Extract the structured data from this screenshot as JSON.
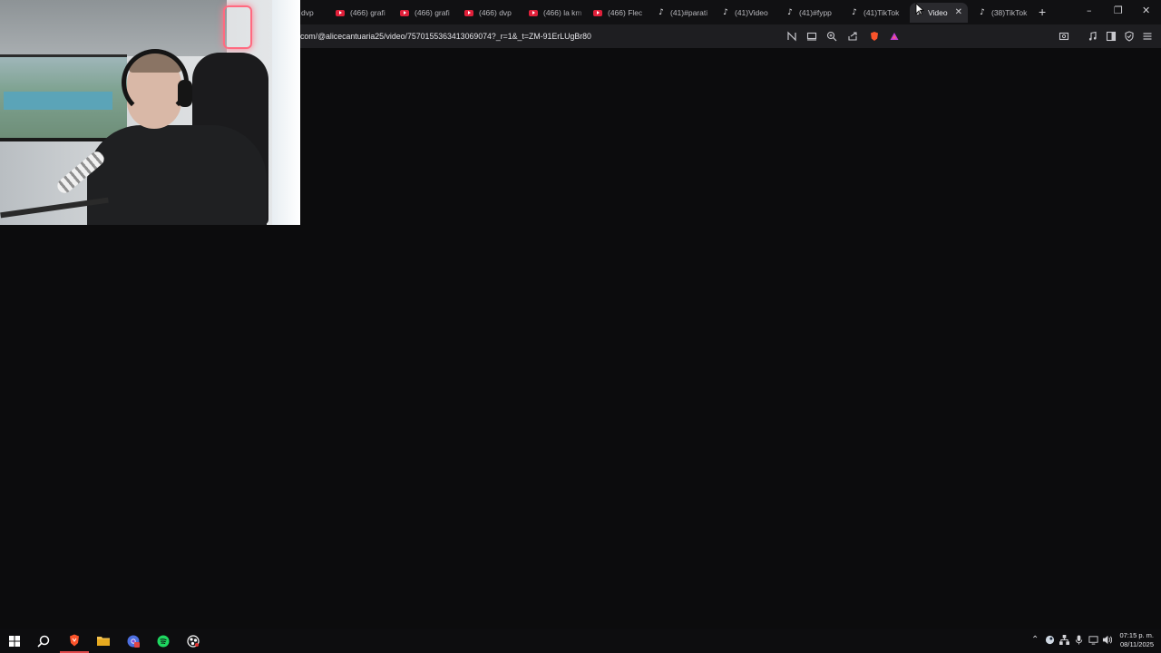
{
  "browser": {
    "tabs": [
      {
        "label": "dvp",
        "icon": "youtube-icon",
        "active": false
      },
      {
        "label": "(466) grafi",
        "icon": "youtube-icon",
        "active": false
      },
      {
        "label": "(466) grafi",
        "icon": "youtube-icon",
        "active": false
      },
      {
        "label": "(466) dvp",
        "icon": "youtube-icon",
        "active": false
      },
      {
        "label": "(466) la km",
        "icon": "youtube-icon",
        "active": false
      },
      {
        "label": "(466) Flec",
        "icon": "youtube-icon",
        "active": false
      },
      {
        "label": "(41)#parati",
        "icon": "tiktok-icon",
        "active": false
      },
      {
        "label": "(41)Video",
        "icon": "tiktok-icon",
        "active": false
      },
      {
        "label": "(41)#fypp",
        "icon": "tiktok-icon",
        "active": false
      },
      {
        "label": "(41)TikTok",
        "icon": "tiktok-icon",
        "active": false
      },
      {
        "label": "Video",
        "icon": "tiktok-icon",
        "active": true
      },
      {
        "label": "(38)TikTok",
        "icon": "tiktok-icon",
        "active": false
      }
    ],
    "new_tab_label": "+",
    "window_controls": {
      "minimize": "–",
      "restore": "❐",
      "close": "✕"
    },
    "url": "com/@alicecantuaria25/video/7570155363413069074?_r=1&_t=ZM-91ErLUgBr80",
    "colors": {
      "accent_brave": "#fb542b",
      "youtube": "#e0203a",
      "background": "#0c0c0d"
    }
  },
  "taskbar": {
    "clock_time": "07:15 p. m.",
    "clock_date": "08/11/2025",
    "pinned": [
      "windows-start-icon",
      "search-icon",
      "brave-browser-icon",
      "file-explorer-icon",
      "chrome-canary-icon",
      "spotify-icon",
      "obs-icon"
    ]
  }
}
